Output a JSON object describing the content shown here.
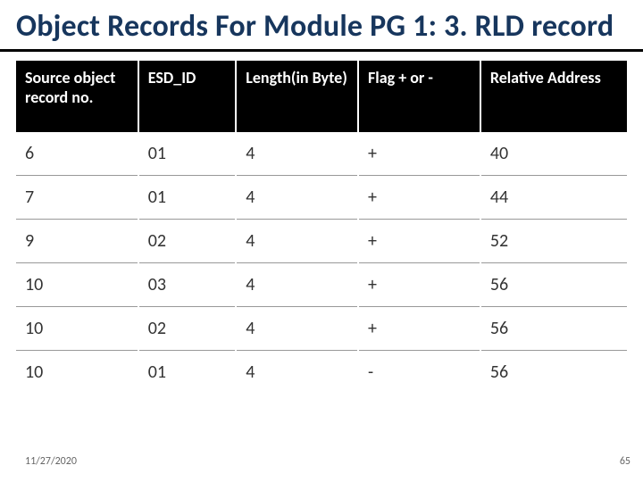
{
  "title": "Object Records For Module PG 1: 3. RLD record",
  "columns": [
    "Source object record no.",
    "ESD_ID",
    "Length(in Byte)",
    "Flag + or -",
    "Relative Address"
  ],
  "rows": [
    {
      "c0": "6",
      "c1": "01",
      "c2": "4",
      "c3": "+",
      "c4": "40"
    },
    {
      "c0": "7",
      "c1": "01",
      "c2": "4",
      "c3": "+",
      "c4": "44"
    },
    {
      "c0": "9",
      "c1": "02",
      "c2": "4",
      "c3": "+",
      "c4": "52"
    },
    {
      "c0": "10",
      "c1": "03",
      "c2": "4",
      "c3": "+",
      "c4": "56"
    },
    {
      "c0": "10",
      "c1": "02",
      "c2": "4",
      "c3": "+",
      "c4": "56"
    },
    {
      "c0": "10",
      "c1": "01",
      "c2": "4",
      "c3": "-",
      "c4": "56"
    }
  ],
  "footer": {
    "date": "11/27/2020",
    "page": "65"
  }
}
